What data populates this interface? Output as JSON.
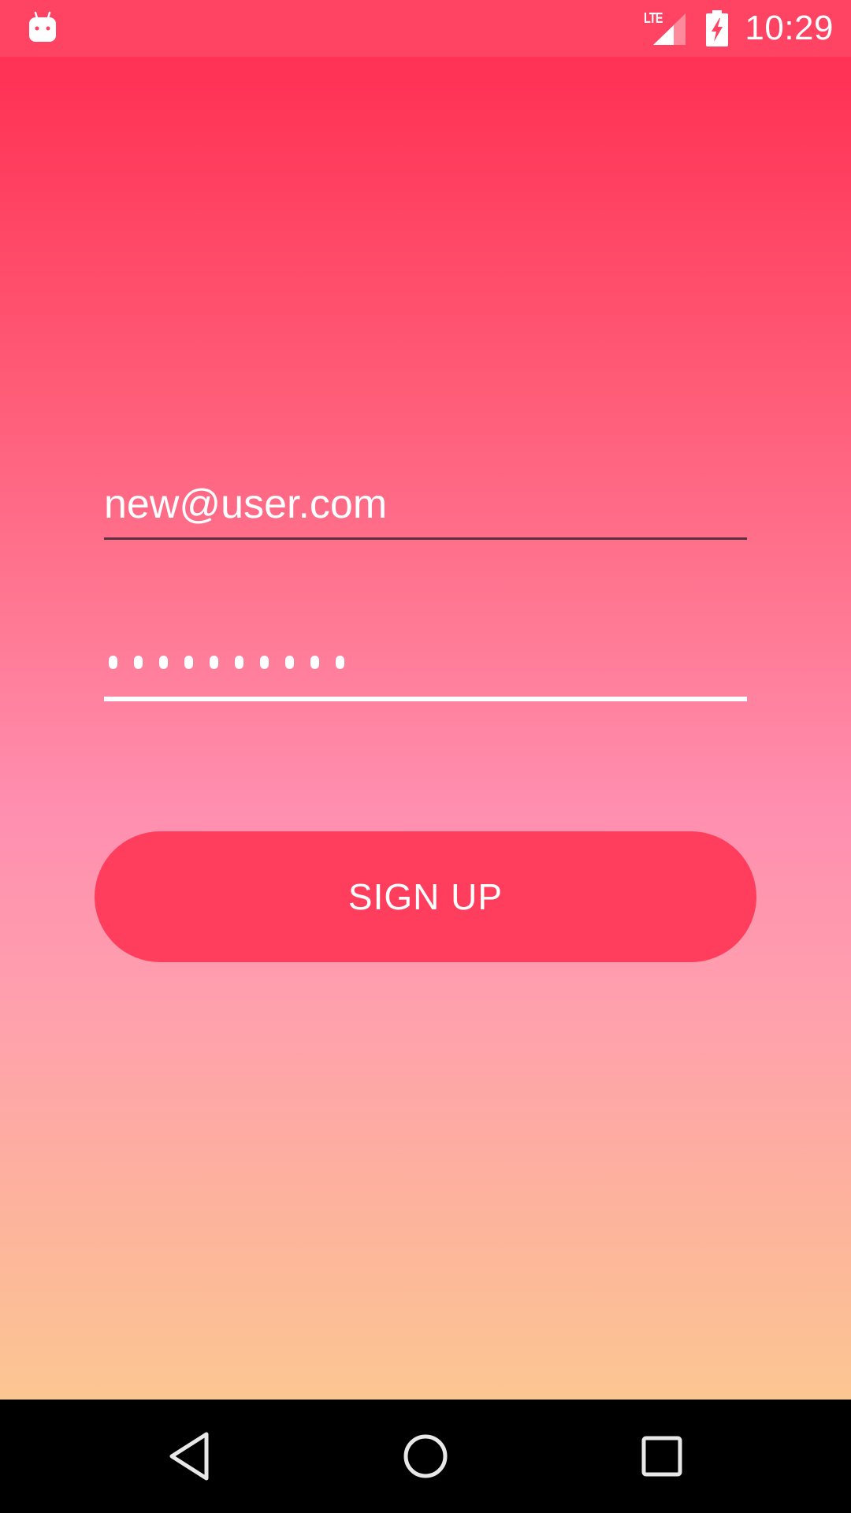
{
  "status_bar": {
    "time": "10:29",
    "network_label": "LTE",
    "app_icon": "android-debug-icon",
    "battery_icon": "battery-charging-icon",
    "signal_icon": "signal-icon"
  },
  "form": {
    "email_value": "new@user.com",
    "password_masked_length": 10,
    "submit_label": "SIGN UP"
  },
  "nav_bar": {
    "back_icon": "back-triangle-icon",
    "home_icon": "home-circle-icon",
    "recents_icon": "recents-square-icon"
  },
  "colors": {
    "accent": "#ff3d5c",
    "gradient_top": "#ff3355",
    "gradient_bottom": "#fcc692"
  }
}
